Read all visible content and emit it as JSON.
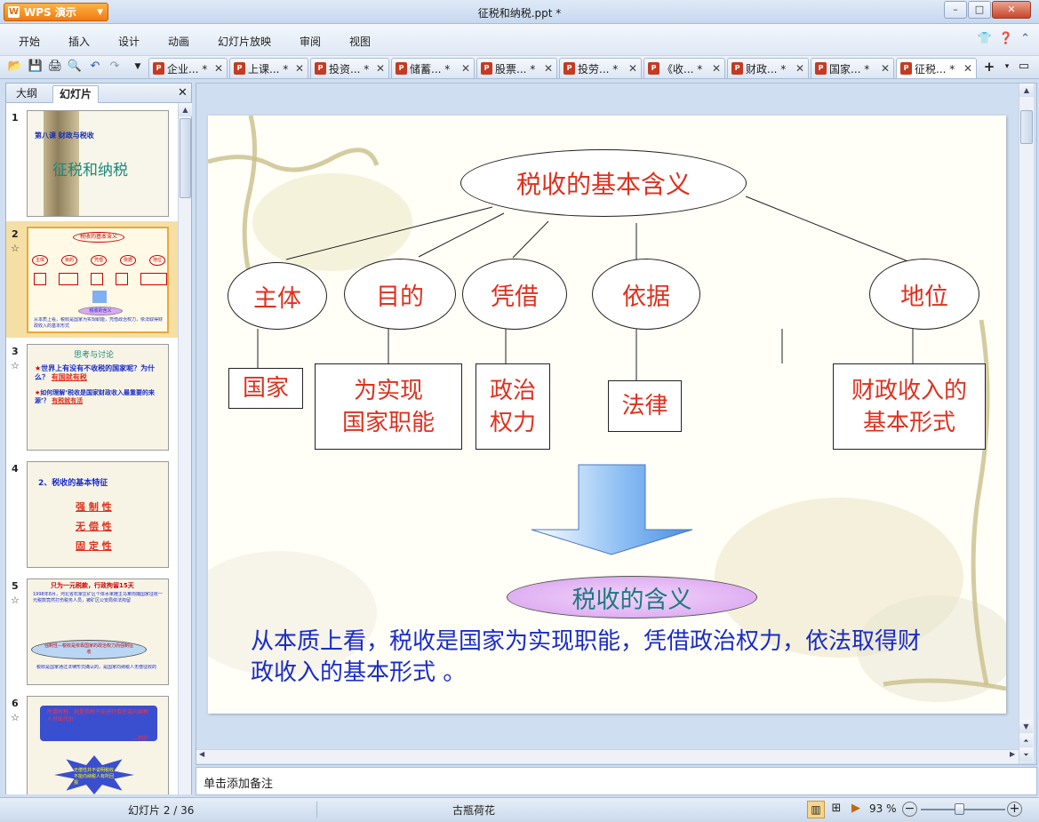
{
  "app": {
    "name": "WPS 演示",
    "window_title": "征税和纳税.ppt *"
  },
  "menu": [
    "开始",
    "插入",
    "设计",
    "动画",
    "幻灯片放映",
    "审阅",
    "视图"
  ],
  "doc_tabs": [
    {
      "label": "企业... *"
    },
    {
      "label": "上课... *"
    },
    {
      "label": "投资... *"
    },
    {
      "label": "储蓄... *"
    },
    {
      "label": "股票... *"
    },
    {
      "label": "投劳... *"
    },
    {
      "label": "《收... *"
    },
    {
      "label": "财政... *"
    },
    {
      "label": "国家... *"
    },
    {
      "label": "征税... *"
    }
  ],
  "left_panel": {
    "tabs": [
      "大纲",
      "幻灯片"
    ],
    "slides": [
      {
        "num": "1",
        "title_small": "第八课 财政与税收",
        "title_big": "征税和纳税"
      },
      {
        "num": "2",
        "mini_title": "税收的基本含义",
        "mini_labels": [
          "主体",
          "目的",
          "凭借",
          "依据",
          "地位"
        ],
        "mini_foot": "税收的含义",
        "mini_text": "从本质上看，税收是国家为实现职能，凭借政治权力，依法取得财政收入的基本形式"
      },
      {
        "num": "3",
        "title": "思考与讨论",
        "q1": "世界上有没有不收税的国家呢？为什么？",
        "a1": "有国就有税",
        "q2": "如何理解‘税收是国家财政收入最重要的来源’？",
        "a2": "有税就有活"
      },
      {
        "num": "4",
        "title": "2、税收的基本特征",
        "items": [
          "强 制 性",
          "无 偿 性",
          "固 定 性"
        ]
      },
      {
        "num": "5",
        "title": "只为一元税款，行政拘留15天",
        "body": "1998年8月，河北省石家庄矿区个体水果摊主马某拘捕国家征收一元税款竟然打伤税务人员，被矿区公安局依法拘留",
        "bubble": "强制性—税收是依靠国家的政治权力而强制征收",
        "foot": "税收是国家通过法律形式确认的，是国家向纳税人无偿征收的"
      },
      {
        "num": "6",
        "scroll": "所谓有税，就是指税不能进行偿还或向纳税人付出代价",
        "author": "—列宁",
        "burst": "无偿性并不说明税收不能向纳税人有所回报"
      }
    ]
  },
  "slide": {
    "root": "税收的基本含义",
    "branches": [
      {
        "label": "主体",
        "box": "国家"
      },
      {
        "label": "目的",
        "box": "为实现\n国家职能"
      },
      {
        "label": "凭借",
        "box": "政治\n权力"
      },
      {
        "label": "依据",
        "box": "法律"
      },
      {
        "label": "地位",
        "box": "财政收入的\n基本形式"
      }
    ],
    "summary_label": "税收的含义",
    "definition": "从本质上看，税收是国家为实现职能，凭借政治权力，依法取得财政收入的基本形式 。"
  },
  "notes_placeholder": "单击添加备注",
  "status": {
    "slide_indicator": "幻灯片 2 / 36",
    "theme": "古瓶荷花",
    "zoom": "93 %",
    "zoom_level": 0.45
  },
  "colors": {
    "accent": "#e0301e",
    "text_blue": "#1a2cc8",
    "wps_orange": "#f07b12",
    "chrome": "#cfdef0"
  },
  "icons": [
    "open-folder-icon",
    "save-icon",
    "print-icon",
    "print-preview-icon",
    "undo-icon",
    "redo-icon",
    "new-tab-icon",
    "normal-view-icon",
    "slide-sorter-icon",
    "slideshow-icon",
    "zoom-out-icon",
    "zoom-in-icon",
    "help-icon",
    "user-icon"
  ]
}
